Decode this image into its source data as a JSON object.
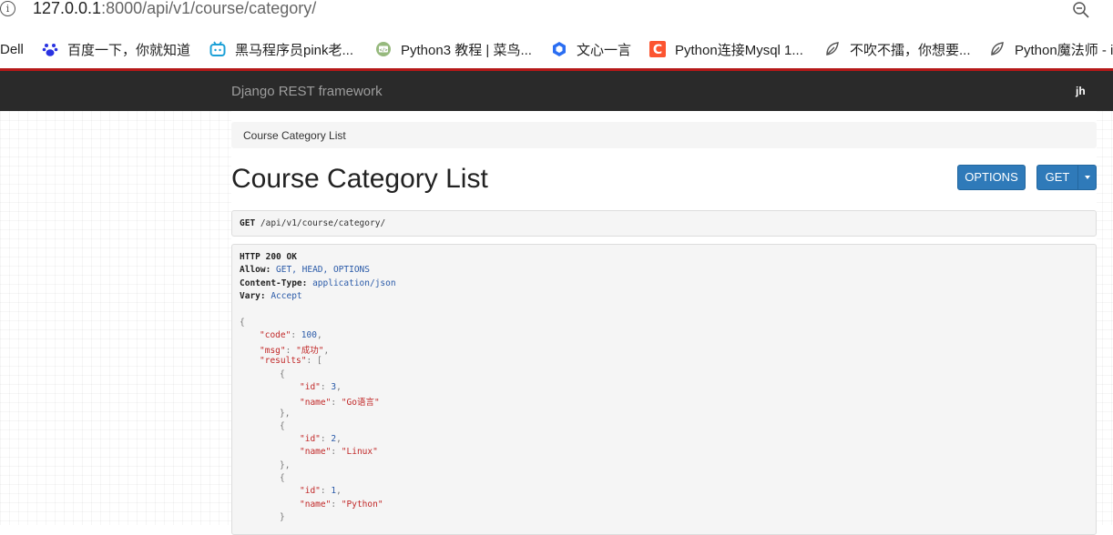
{
  "browser": {
    "url_host": "127.0.0.1",
    "url_rest": ":8000/api/v1/course/category/",
    "bookmarks": [
      {
        "label": "Dell",
        "icon": "none"
      },
      {
        "label": "百度一下，你就知道",
        "icon": "baidu-paw-icon"
      },
      {
        "label": "黑马程序员pink老...",
        "icon": "bilibili-tv-icon"
      },
      {
        "label": "Python3 教程 | 菜鸟...",
        "icon": "runoob-code-icon"
      },
      {
        "label": "文心一言",
        "icon": "wenxin-cube-icon"
      },
      {
        "label": "Python连接Mysql 1...",
        "icon": "csdn-c-icon"
      },
      {
        "label": "不吹不擂，你想要...",
        "icon": "zhihu-leaf-icon"
      },
      {
        "label": "Python魔法师 - i",
        "icon": "zhihu-leaf-icon"
      }
    ],
    "colors": {
      "accent_line": "#b51818"
    }
  },
  "navbar": {
    "brand": "Django REST framework",
    "user": "jh",
    "bg_color": "#2a2a2a"
  },
  "breadcrumb": "Course Category List",
  "page_title": "Course Category List",
  "buttons": {
    "options": "OPTIONS",
    "get": "GET",
    "color": "#2f7ab9"
  },
  "request": {
    "method": "GET",
    "path": " /api/v1/course/category/"
  },
  "response": {
    "status": "HTTP 200 OK",
    "headers": [
      {
        "key": "Allow:",
        "value": " GET, HEAD, OPTIONS"
      },
      {
        "key": "Content-Type:",
        "value": " application/json"
      },
      {
        "key": "Vary:",
        "value": " Accept"
      }
    ],
    "body": {
      "open_brace": "{",
      "code_key": "\"code\"",
      "code_val": "100",
      "msg_key": "\"msg\"",
      "msg_val": "\"成功\"",
      "results_key": "\"results\"",
      "open_bracket": "[",
      "items": [
        {
          "id_key": "\"id\"",
          "id": "3",
          "name_key": "\"name\"",
          "name": "\"Go语言\""
        },
        {
          "id_key": "\"id\"",
          "id": "2",
          "name_key": "\"name\"",
          "name": "\"Linux\""
        },
        {
          "id_key": "\"id\"",
          "id": "1",
          "name_key": "\"name\"",
          "name": "\"Python\""
        }
      ]
    }
  }
}
